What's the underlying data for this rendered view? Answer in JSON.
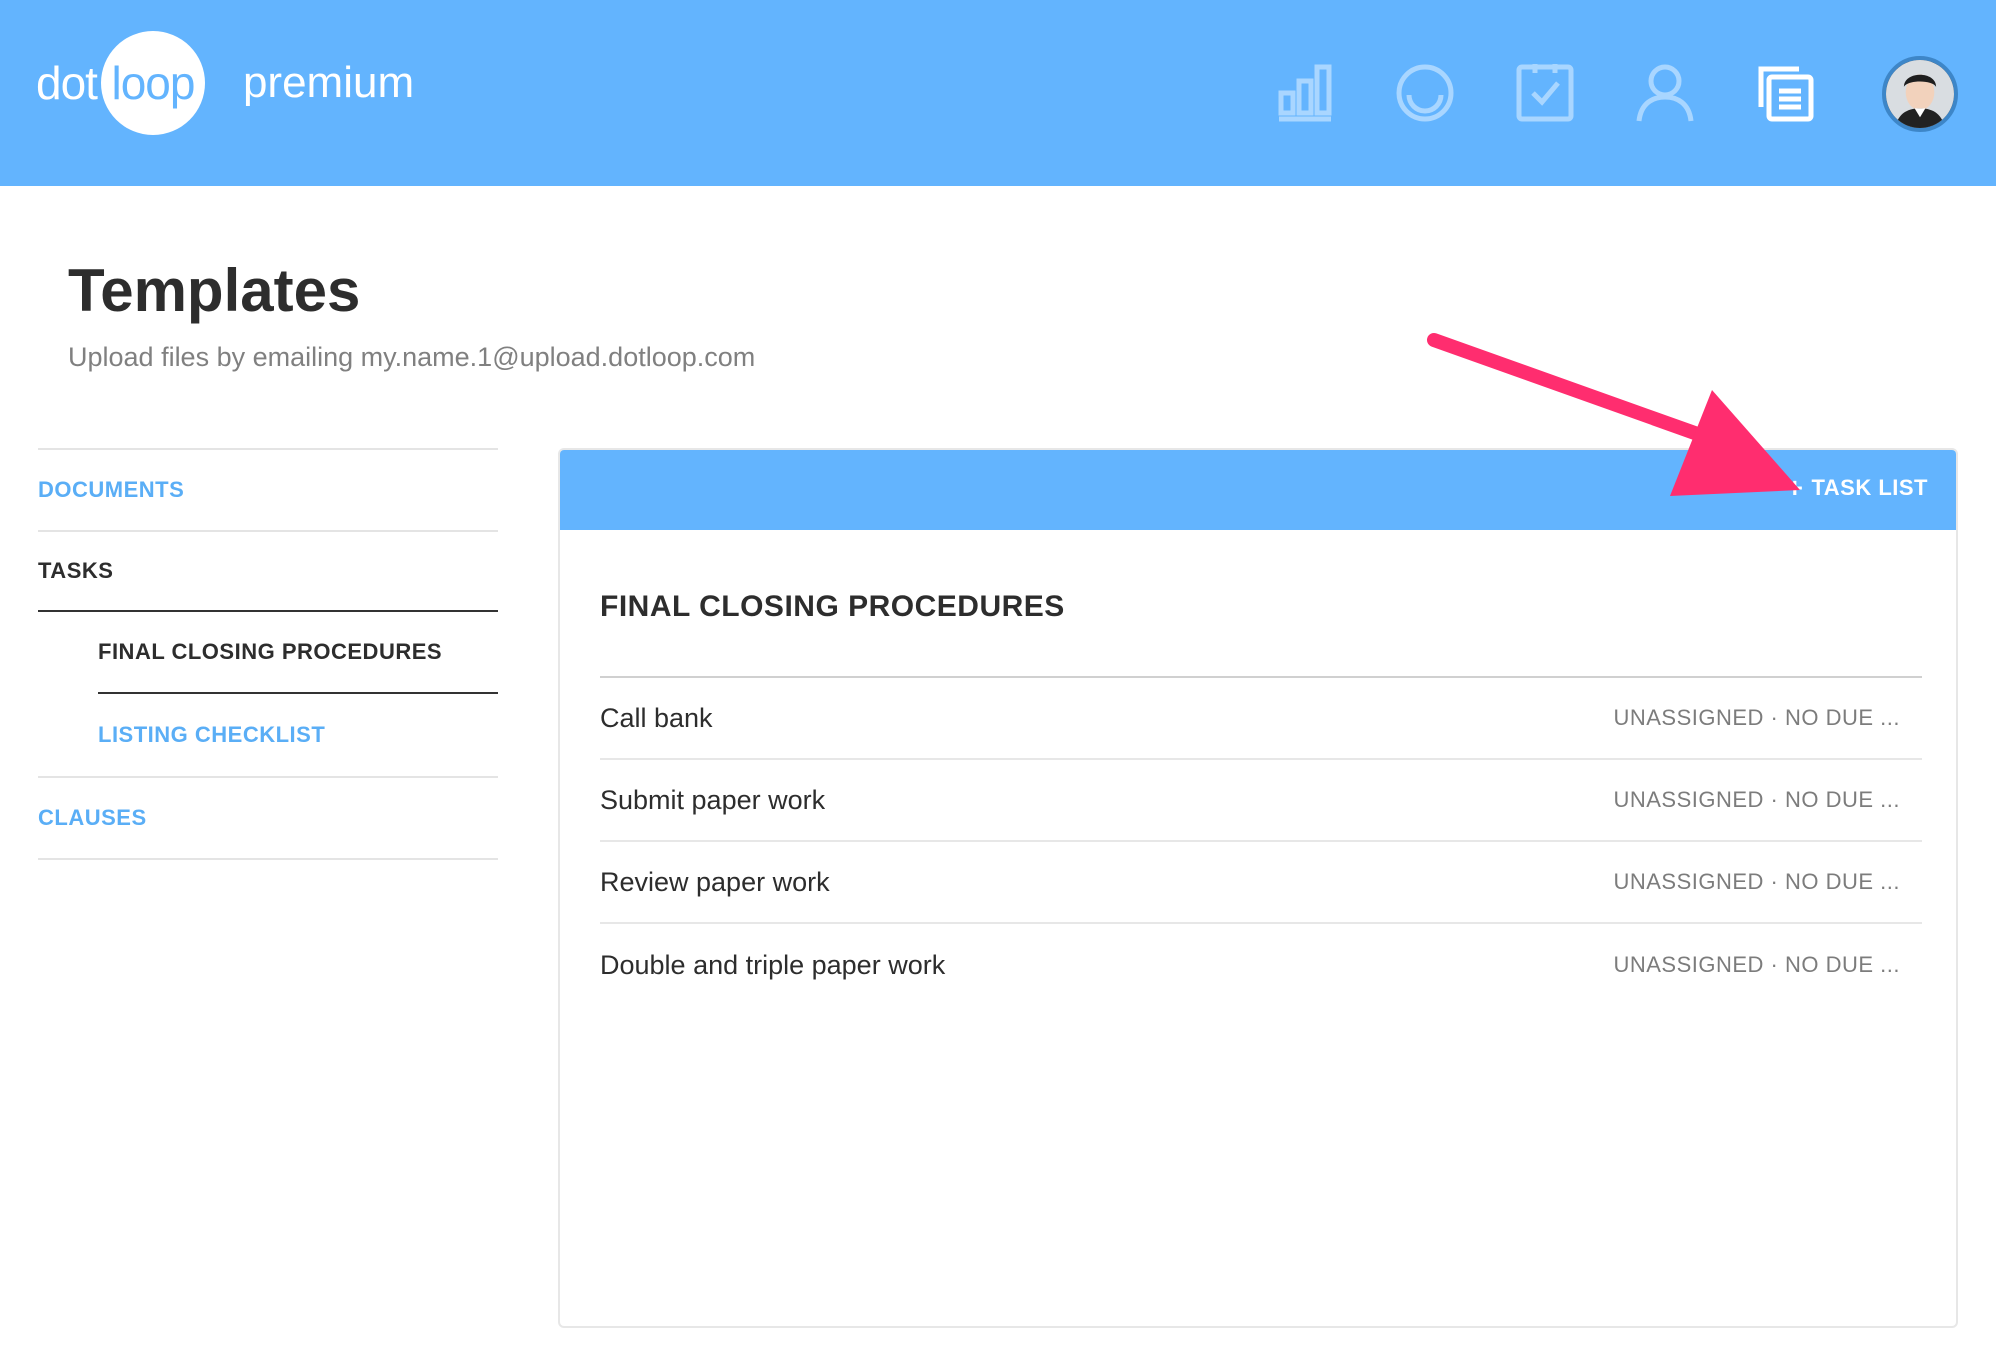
{
  "header": {
    "logo": {
      "dot": "dot",
      "loop": "loop",
      "tier": "premium"
    },
    "nav": [
      {
        "name": "reports-icon"
      },
      {
        "name": "loops-icon"
      },
      {
        "name": "tasks-icon"
      },
      {
        "name": "people-icon"
      },
      {
        "name": "templates-icon"
      }
    ],
    "colors": {
      "brand": "#63b4fe",
      "link": "#5aaef6",
      "annotation": "#ff2d6f"
    }
  },
  "page": {
    "title": "Templates",
    "subtitle": "Upload files by emailing my.name.1@upload.dotloop.com"
  },
  "sidebar": {
    "documents": "DOCUMENTS",
    "tasks": "TASKS",
    "sub_items": [
      "FINAL CLOSING PROCEDURES",
      "LISTING CHECKLIST"
    ],
    "clauses": "CLAUSES"
  },
  "panel": {
    "add_label": "TASK LIST",
    "list_title": "FINAL CLOSING PROCEDURES",
    "tasks": [
      {
        "name": "Call bank",
        "meta": "UNASSIGNED · NO DUE ..."
      },
      {
        "name": "Submit paper work",
        "meta": "UNASSIGNED · NO DUE ..."
      },
      {
        "name": "Review paper work",
        "meta": "UNASSIGNED · NO DUE ..."
      },
      {
        "name": "Double and triple paper work",
        "meta": "UNASSIGNED · NO DUE ..."
      }
    ]
  }
}
